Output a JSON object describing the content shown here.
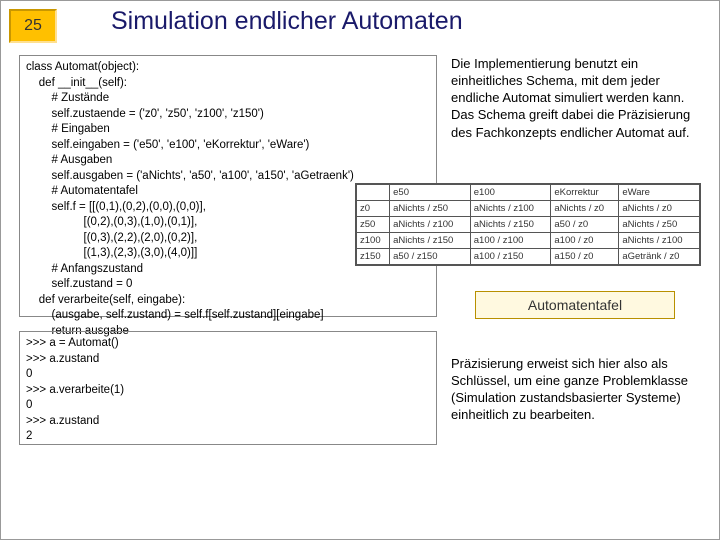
{
  "slide": {
    "number": "25"
  },
  "title": "Simulation endlicher Automaten",
  "code_top": "class Automat(object):\n    def __init__(self):\n        # Zustände\n        self.zustaende = ('z0', 'z50', 'z100', 'z150')\n        # Eingaben\n        self.eingaben = ('e50', 'e100', 'eKorrektur', 'eWare')\n        # Ausgaben\n        self.ausgaben = ('aNichts', 'a50', 'a100', 'a150', 'aGetraenk')\n        # Automatentafel\n        self.f = [[(0,1),(0,2),(0,0),(0,0)],\n                  [(0,2),(0,3),(1,0),(0,1)],\n                  [(0,3),(2,2),(2,0),(0,2)],\n                  [(1,3),(2,3),(3,0),(4,0)]]\n        # Anfangszustand\n        self.zustand = 0\n    def verarbeite(self, eingabe):\n        (ausgabe, self.zustand) = self.f[self.zustand][eingabe]\n        return ausgabe",
  "code_bottom": ">>> a = Automat()\n>>> a.zustand\n0\n>>> a.verarbeite(1)\n0\n>>> a.zustand\n2",
  "explain1": "Die Implementierung benutzt ein einheitliches Schema, mit dem jeder endliche Automat simuliert werden kann. Das Schema greift dabei die Präzisierung des Fachkonzepts endlicher Automat auf.",
  "caption": "Automatentafel",
  "explain2": "Präzisierung erweist sich hier also als Schlüssel, um eine ganze Problemklasse (Simulation zustandsbasierter Systeme) einheitlich zu bearbeiten.",
  "table": {
    "headers": [
      "",
      "e50",
      "e100",
      "eKorrektur",
      "eWare"
    ],
    "rows": [
      [
        "z0",
        "aNichts / z50",
        "aNichts / z100",
        "aNichts / z0",
        "aNichts / z0"
      ],
      [
        "z50",
        "aNichts / z100",
        "aNichts / z150",
        "a50 / z0",
        "aNichts / z50"
      ],
      [
        "z100",
        "aNichts / z150",
        "a100 / z100",
        "a100 / z0",
        "aNichts / z100"
      ],
      [
        "z150",
        "a50 / z150",
        "a100 / z150",
        "a150 / z0",
        "aGetränk / z0"
      ]
    ]
  }
}
